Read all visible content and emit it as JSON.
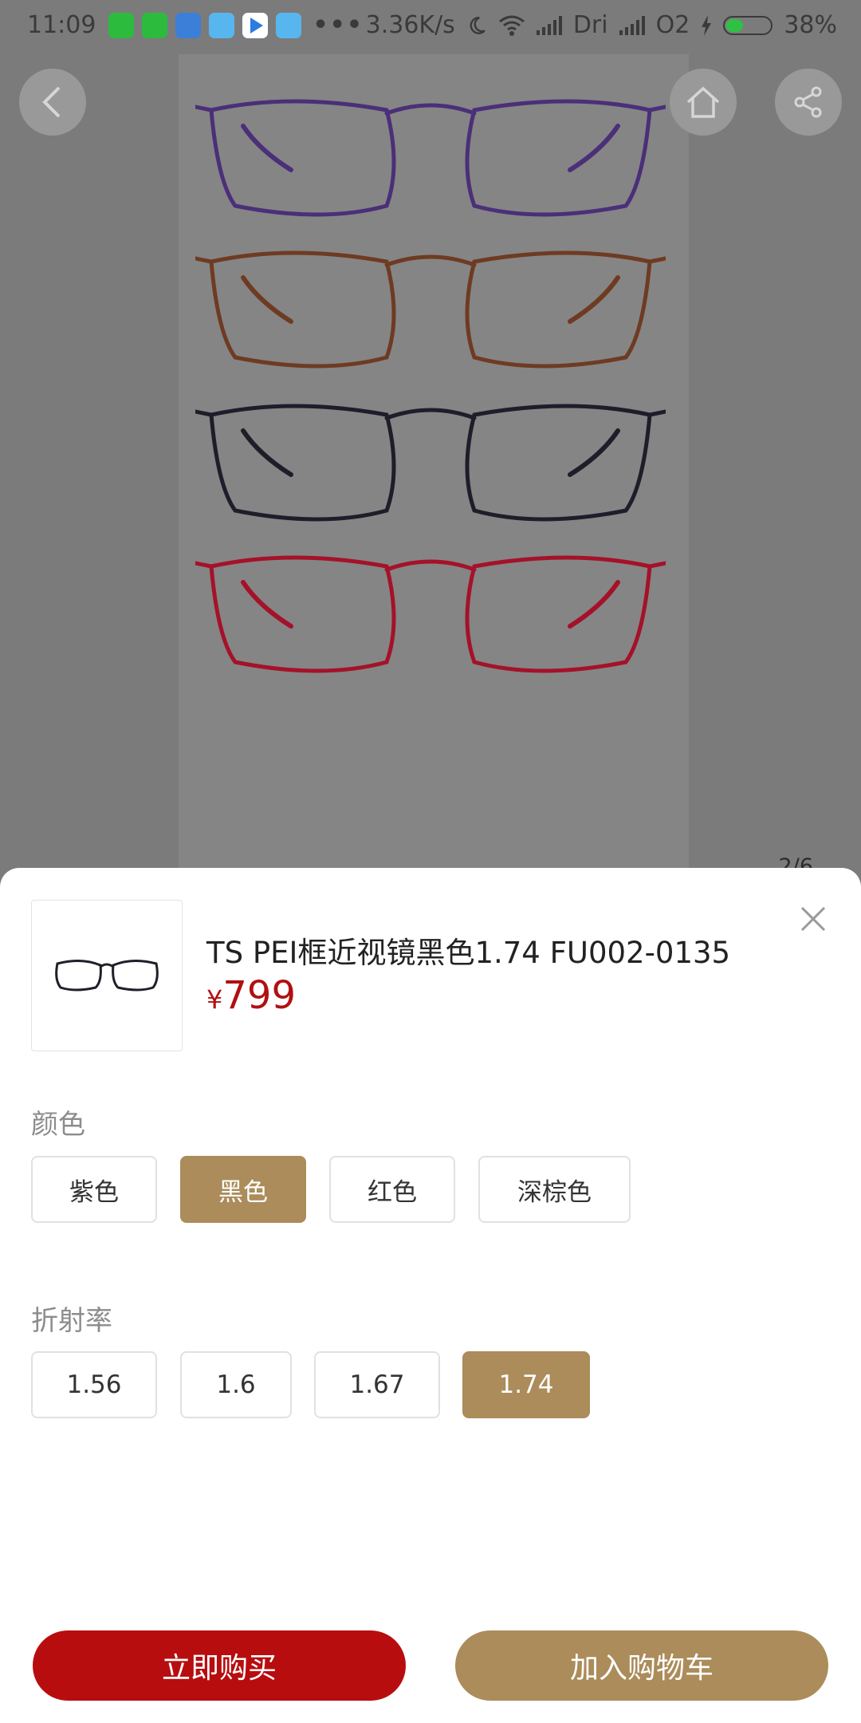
{
  "status_bar": {
    "time": "11:09",
    "net_speed": "3.36K/s",
    "carrier1": "Dri",
    "carrier2": "O2",
    "battery_text": "38%",
    "battery_level": 0.38
  },
  "gallery": {
    "page_indicator": "2/6",
    "frame_colors": [
      "#4b2f79",
      "#6e3b22",
      "#1e1e2a",
      "#a4122a"
    ]
  },
  "product": {
    "title": "TS PEI框近视镜黑色1.74 FU002-0135",
    "price_symbol": "¥",
    "price_value": "799"
  },
  "color_section": {
    "label": "颜色",
    "options": [
      {
        "label": "紫色",
        "selected": false
      },
      {
        "label": "黑色",
        "selected": true
      },
      {
        "label": "红色",
        "selected": false
      },
      {
        "label": "深棕色",
        "selected": false
      }
    ]
  },
  "index_section": {
    "label": "折射率",
    "options": [
      {
        "label": "1.56",
        "selected": false
      },
      {
        "label": "1.6",
        "selected": false
      },
      {
        "label": "1.67",
        "selected": false
      },
      {
        "label": "1.74",
        "selected": true
      }
    ]
  },
  "actions": {
    "buy_now": "立即购买",
    "add_to_cart": "加入购物车"
  },
  "colors": {
    "accent_gold": "#ab8c5a",
    "brand_red": "#b80d0f",
    "price_red": "#b10f11"
  }
}
